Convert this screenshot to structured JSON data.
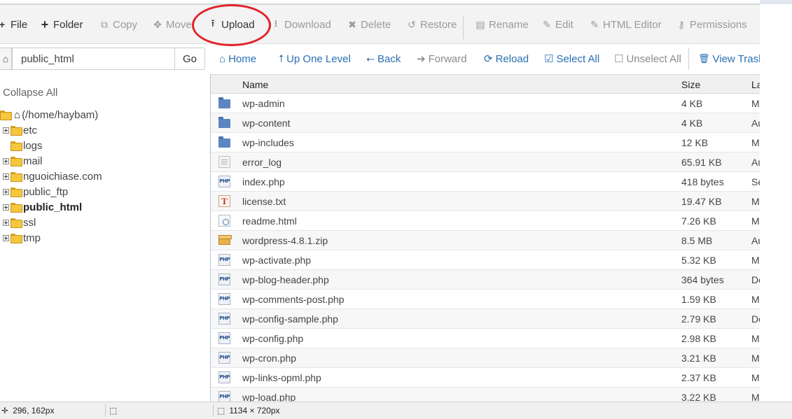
{
  "toolbar": {
    "items": [
      {
        "label": "File",
        "icon": "+"
      },
      {
        "label": "Folder",
        "icon": "+"
      },
      {
        "label": "Copy",
        "icon": "⧉"
      },
      {
        "label": "Move",
        "icon": "✥"
      },
      {
        "label": "Upload",
        "icon": "⭱"
      },
      {
        "label": "Download",
        "icon": "⭳"
      },
      {
        "label": "Delete",
        "icon": "✖"
      },
      {
        "label": "Restore",
        "icon": "↺"
      },
      {
        "label": "Rename",
        "icon": "▤"
      },
      {
        "label": "Edit",
        "icon": "✎"
      },
      {
        "label": "HTML Editor",
        "icon": "✎"
      },
      {
        "label": "Permissions",
        "icon": "⚷"
      }
    ]
  },
  "path": {
    "value": "public_html",
    "go_label": "Go"
  },
  "nav": {
    "items": [
      {
        "label": "Home",
        "icon": "⌂"
      },
      {
        "label": "Up One Level",
        "icon": "⭡"
      },
      {
        "label": "Back",
        "icon": "⭠"
      },
      {
        "label": "Forward",
        "icon": "➔"
      },
      {
        "label": "Reload",
        "icon": "⟳"
      },
      {
        "label": "Select All",
        "icon": "☑"
      },
      {
        "label": "Unselect All",
        "icon": "☐"
      },
      {
        "label": "View Trash",
        "icon": "🗑"
      }
    ]
  },
  "tree": {
    "collapse_all": "Collapse All",
    "root": "(/home/haybam)",
    "items": [
      {
        "label": "etc",
        "expandable": true
      },
      {
        "label": "logs",
        "expandable": false
      },
      {
        "label": "mail",
        "expandable": true
      },
      {
        "label": "nguoichiase.com",
        "expandable": true
      },
      {
        "label": "public_ftp",
        "expandable": true
      },
      {
        "label": "public_html",
        "expandable": true,
        "selected": true
      },
      {
        "label": "ssl",
        "expandable": true
      },
      {
        "label": "tmp",
        "expandable": true
      }
    ]
  },
  "table": {
    "headers": {
      "name": "Name",
      "size": "Size",
      "modified": "La"
    },
    "rows": [
      {
        "name": "wp-admin",
        "size": "4 KB",
        "mod": "M",
        "type": "folder"
      },
      {
        "name": "wp-content",
        "size": "4 KB",
        "mod": "Au",
        "type": "folder"
      },
      {
        "name": "wp-includes",
        "size": "12 KB",
        "mod": "M",
        "type": "folder"
      },
      {
        "name": "error_log",
        "size": "65.91 KB",
        "mod": "Au",
        "type": "log"
      },
      {
        "name": "index.php",
        "size": "418 bytes",
        "mod": "Se",
        "type": "php"
      },
      {
        "name": "license.txt",
        "size": "19.47 KB",
        "mod": "M",
        "type": "txt"
      },
      {
        "name": "readme.html",
        "size": "7.26 KB",
        "mod": "M",
        "type": "html"
      },
      {
        "name": "wordpress-4.8.1.zip",
        "size": "8.5 MB",
        "mod": "Au",
        "type": "zip"
      },
      {
        "name": "wp-activate.php",
        "size": "5.32 KB",
        "mod": "M",
        "type": "php"
      },
      {
        "name": "wp-blog-header.php",
        "size": "364 bytes",
        "mod": "De",
        "type": "php"
      },
      {
        "name": "wp-comments-post.php",
        "size": "1.59 KB",
        "mod": "M",
        "type": "php"
      },
      {
        "name": "wp-config-sample.php",
        "size": "2.79 KB",
        "mod": "De",
        "type": "php"
      },
      {
        "name": "wp-config.php",
        "size": "2.98 KB",
        "mod": "M",
        "type": "php"
      },
      {
        "name": "wp-cron.php",
        "size": "3.21 KB",
        "mod": "M",
        "type": "php"
      },
      {
        "name": "wp-links-opml.php",
        "size": "2.37 KB",
        "mod": "M",
        "type": "php"
      },
      {
        "name": "wp-load.php",
        "size": "3.22 KB",
        "mod": "M",
        "type": "php"
      }
    ]
  },
  "status": {
    "cursor": "296, 162px",
    "dimensions": "1134 × 720px"
  },
  "colors": {
    "link": "#2a6fb4",
    "annotation": "#e22228"
  }
}
